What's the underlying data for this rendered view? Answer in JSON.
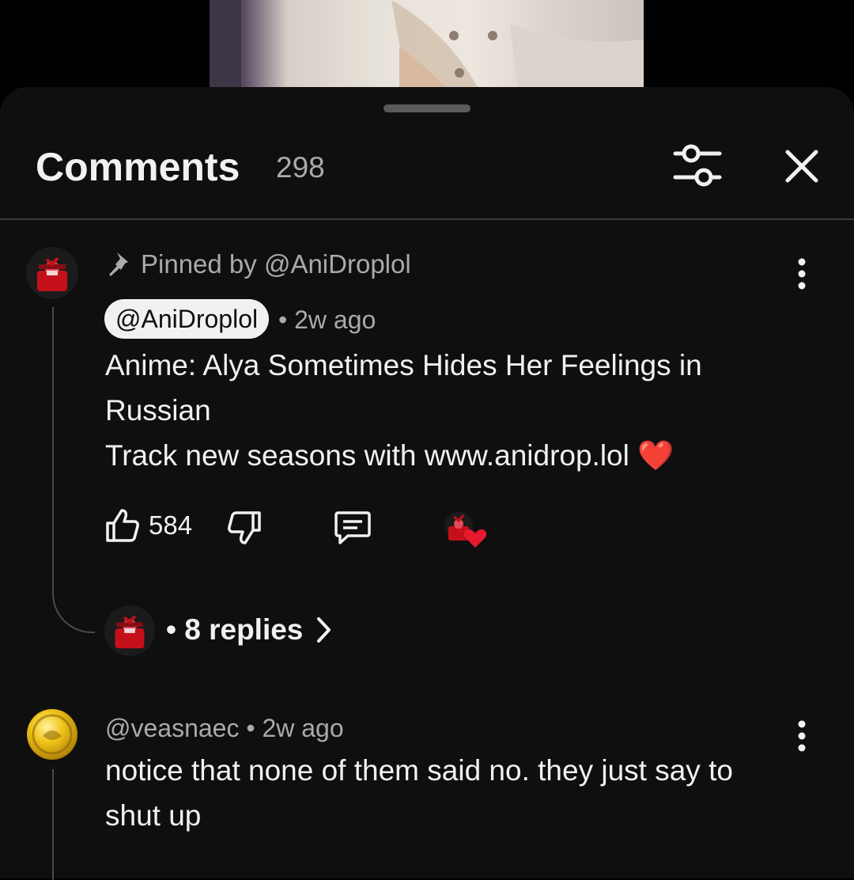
{
  "header": {
    "title": "Comments",
    "count": "298"
  },
  "comments": [
    {
      "pinned_label": "Pinned by @AniDroplol",
      "author": "@AniDroplol",
      "time": "• 2w ago",
      "lines": [
        "Anime: Alya Sometimes Hides Her Feelings in",
        "Russian",
        "Track new seasons with www.anidrop.lol ❤️"
      ],
      "likes": "584",
      "replies": "• 8 replies"
    },
    {
      "author_meta": "@veasnaec • 2w ago",
      "lines": [
        "notice that none of them said no. they just say to",
        "shut up"
      ]
    }
  ],
  "colors": {
    "panel": "#0f0f0f",
    "text": "#f1f1f1",
    "secondary": "#aaaaaa",
    "heart": "#e8192c"
  },
  "icons": [
    "filter-icon",
    "close-icon",
    "pin-icon",
    "more-vert-icon",
    "thumbs-up-icon",
    "thumbs-down-icon",
    "reply-icon",
    "heart-icon",
    "chevron-right-icon"
  ]
}
